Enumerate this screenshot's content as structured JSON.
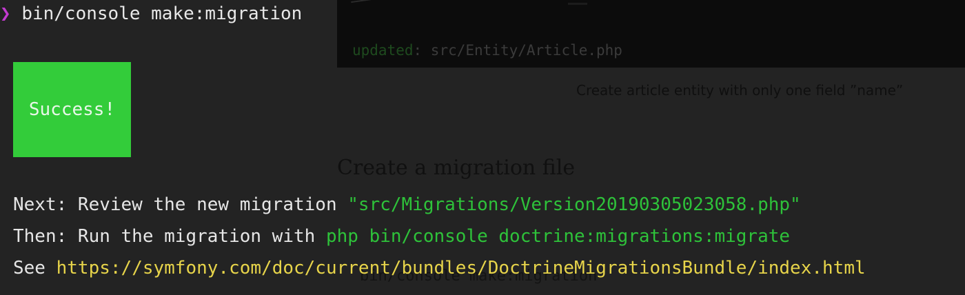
{
  "terminal": {
    "prompt_symbol": "❯",
    "command": "bin/console make:migration",
    "success_label": "Success!",
    "next_prefix": "Next: Review the new migration ",
    "next_path": "\"src/Migrations/Version20190305023058.php\"",
    "then_prefix": "Then: Run the migration with ",
    "then_command": "php bin/console doctrine:migrations:migrate",
    "see_prefix": "See ",
    "see_url": "https://symfony.com/doc/current/bundles/DoctrineMigrationsBundle/index.html"
  },
  "previous_output": {
    "updated_label": "updated",
    "updated_path": ": src/Entity/Article.php"
  },
  "captions": {
    "entity_caption": "Create article entity with only one field ”name”",
    "migration_heading": "Create a migration file",
    "migration_command": "bin/console make:migration"
  },
  "colors": {
    "background": "#232323",
    "prompt_symbol": "#c33bd0",
    "success_bg": "#33cc3a",
    "green_text": "#2ec23a",
    "url_yellow": "#e7d44a"
  }
}
